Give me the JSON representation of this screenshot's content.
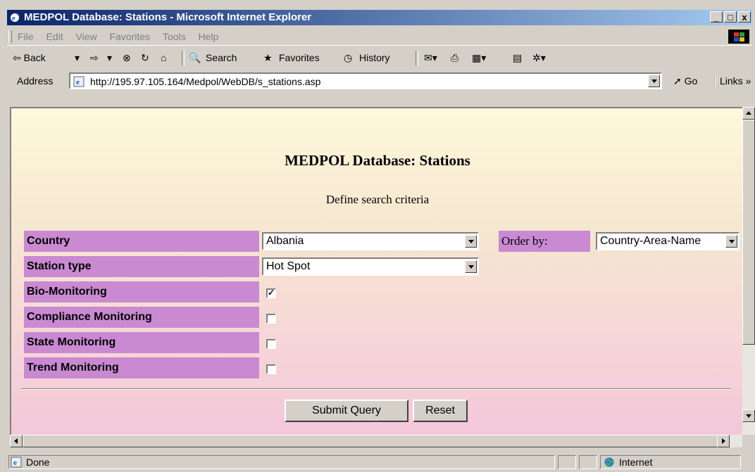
{
  "window": {
    "title": "MEDPOL Database: Stations - Microsoft Internet Explorer",
    "controls": {
      "minimize": "_",
      "maximize": "□",
      "close": "x"
    }
  },
  "menu": [
    "File",
    "Edit",
    "View",
    "Favorites",
    "Tools",
    "Help"
  ],
  "toolbar": {
    "back": "⇦ Back",
    "search": "Search",
    "favorites": "Favorites",
    "history": "History"
  },
  "address": {
    "label": "Address",
    "url": "http://195.97.105.164/Medpol/WebDB/s_stations.asp",
    "go": "Go",
    "links": "Links »"
  },
  "page": {
    "title": "MEDPOL Database: Stations",
    "subtitle": "Define search criteria",
    "fields": {
      "country_label": "Country",
      "country_value": "Albania",
      "station_type_label": "Station type",
      "station_type_value": "Hot Spot",
      "bio_label": "Bio-Monitoring",
      "bio_checked": true,
      "compliance_label": "Compliance Monitoring",
      "compliance_checked": false,
      "state_label": "State Monitoring",
      "state_checked": false,
      "trend_label": "Trend Monitoring",
      "trend_checked": false,
      "order_label": "Order by:",
      "order_value": "Country-Area-Name"
    },
    "submit_label": "Submit Query",
    "reset_label": "Reset"
  },
  "status": {
    "text": "Done",
    "zone": "Internet"
  },
  "colors": {
    "label_bg": "#c98ad2",
    "title_bar": "#0a246a"
  }
}
